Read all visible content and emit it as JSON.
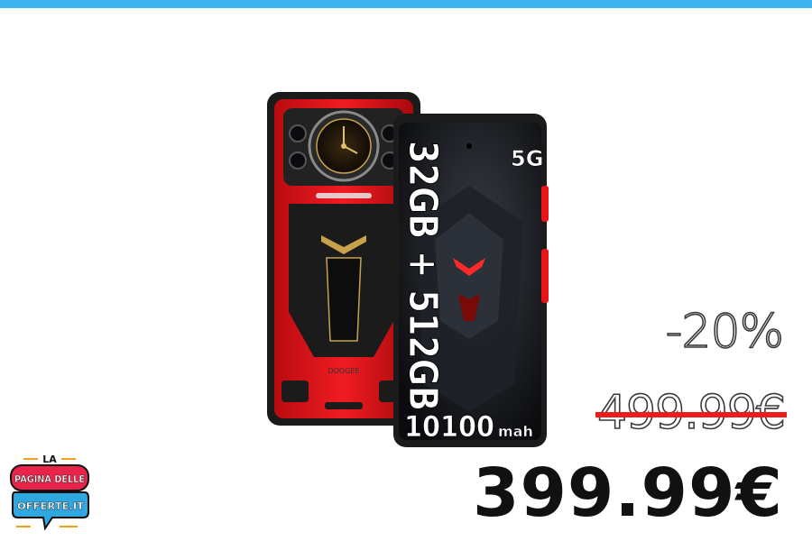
{
  "colors": {
    "accent_bar": "#3db3f0",
    "phone_red": "#e8141a",
    "strike": "#ec1c1c"
  },
  "product": {
    "screen_text": {
      "memory": "32GB + 512GB",
      "network": "5G",
      "battery_number": "10100",
      "battery_unit": "mah"
    },
    "brand_mark": "DOOGEE"
  },
  "pricing": {
    "discount": "-20%",
    "old_price": "499.99€",
    "new_price": "399.99€"
  },
  "logo": {
    "top": "LA",
    "line1": "PAGINA DELLE",
    "line2": "OFFERTE.IT"
  }
}
